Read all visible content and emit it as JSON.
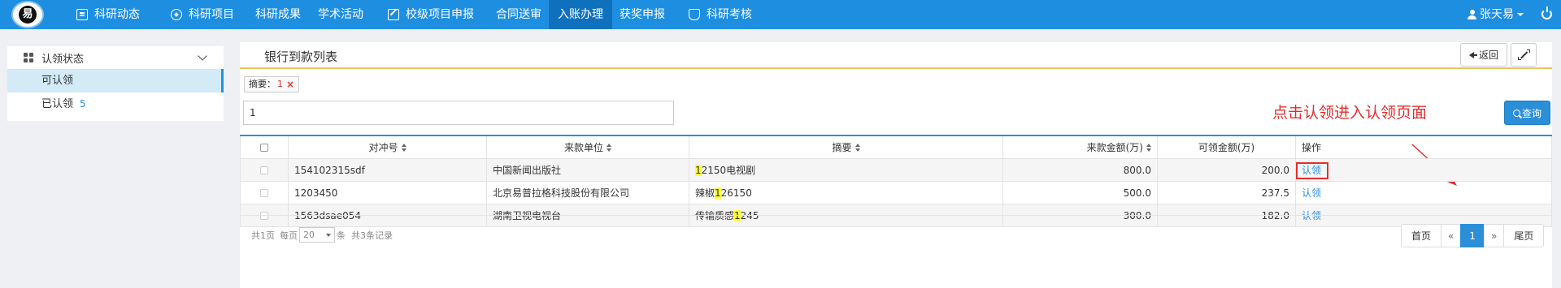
{
  "brand": {
    "logo_glyph": "易"
  },
  "nav": {
    "items": [
      {
        "label": "科研动态",
        "icon": "doc-icon"
      },
      {
        "label": "科研项目",
        "icon": "compass-icon"
      },
      {
        "label": "科研成果",
        "icon": ""
      },
      {
        "label": "学术活动",
        "icon": ""
      },
      {
        "label": "校级项目申报",
        "icon": "edit-icon"
      },
      {
        "label": "合同送审",
        "icon": ""
      },
      {
        "label": "入账办理",
        "icon": "",
        "active": true
      },
      {
        "label": "获奖申报",
        "icon": ""
      },
      {
        "label": "科研考核",
        "icon": "cup-icon"
      }
    ],
    "user_name": "张天易"
  },
  "sidebar": {
    "title": "认领状态",
    "items": [
      {
        "label": "可认领",
        "count": "",
        "active": true
      },
      {
        "label": "已认领",
        "count": "5",
        "active": false
      }
    ]
  },
  "panel": {
    "title": "银行到款列表",
    "back_label": "返回"
  },
  "filter": {
    "tag_label": "摘要：",
    "tag_value": "1",
    "tag_remove": "×",
    "search_value": "1",
    "query_label": "查询"
  },
  "annotation": "点击认领进入认领页面",
  "table": {
    "headers": [
      "对冲号",
      "来款单位",
      "摘要",
      "来款金额(万)",
      "可领金额(万)",
      "操作"
    ],
    "rows": [
      {
        "code": "154102315sdf",
        "unit": "中国新闻出版社",
        "summary_pre": "",
        "summary_hl": "1",
        "summary_post": "2150电视剧",
        "amount": "800.0",
        "available": "200.0",
        "action": "认领"
      },
      {
        "code": "1203450",
        "unit": "北京易普拉格科技股份有限公司",
        "summary_pre": "辣椒",
        "summary_hl": "1",
        "summary_post": "26150",
        "amount": "500.0",
        "available": "237.5",
        "action": "认领"
      },
      {
        "code": "1563dsae054",
        "unit": "湖南卫视电视台",
        "summary_pre": "传输质感",
        "summary_hl": "1",
        "summary_post": "245",
        "amount": "300.0",
        "available": "182.0",
        "action": "认领"
      }
    ]
  },
  "footer": {
    "pages_text": "共1页",
    "per_page_label": "每页",
    "per_page_value": "20",
    "records_text": "条  共3条记录",
    "pager": {
      "first": "首页",
      "prev": "«",
      "current": "1",
      "next": "»",
      "last": "尾页"
    }
  },
  "colors": {
    "nav_bg": "#1e8fe0",
    "accent": "#2b8fd8",
    "highlight": "#ffff35",
    "annotation": "#e02f2f"
  }
}
